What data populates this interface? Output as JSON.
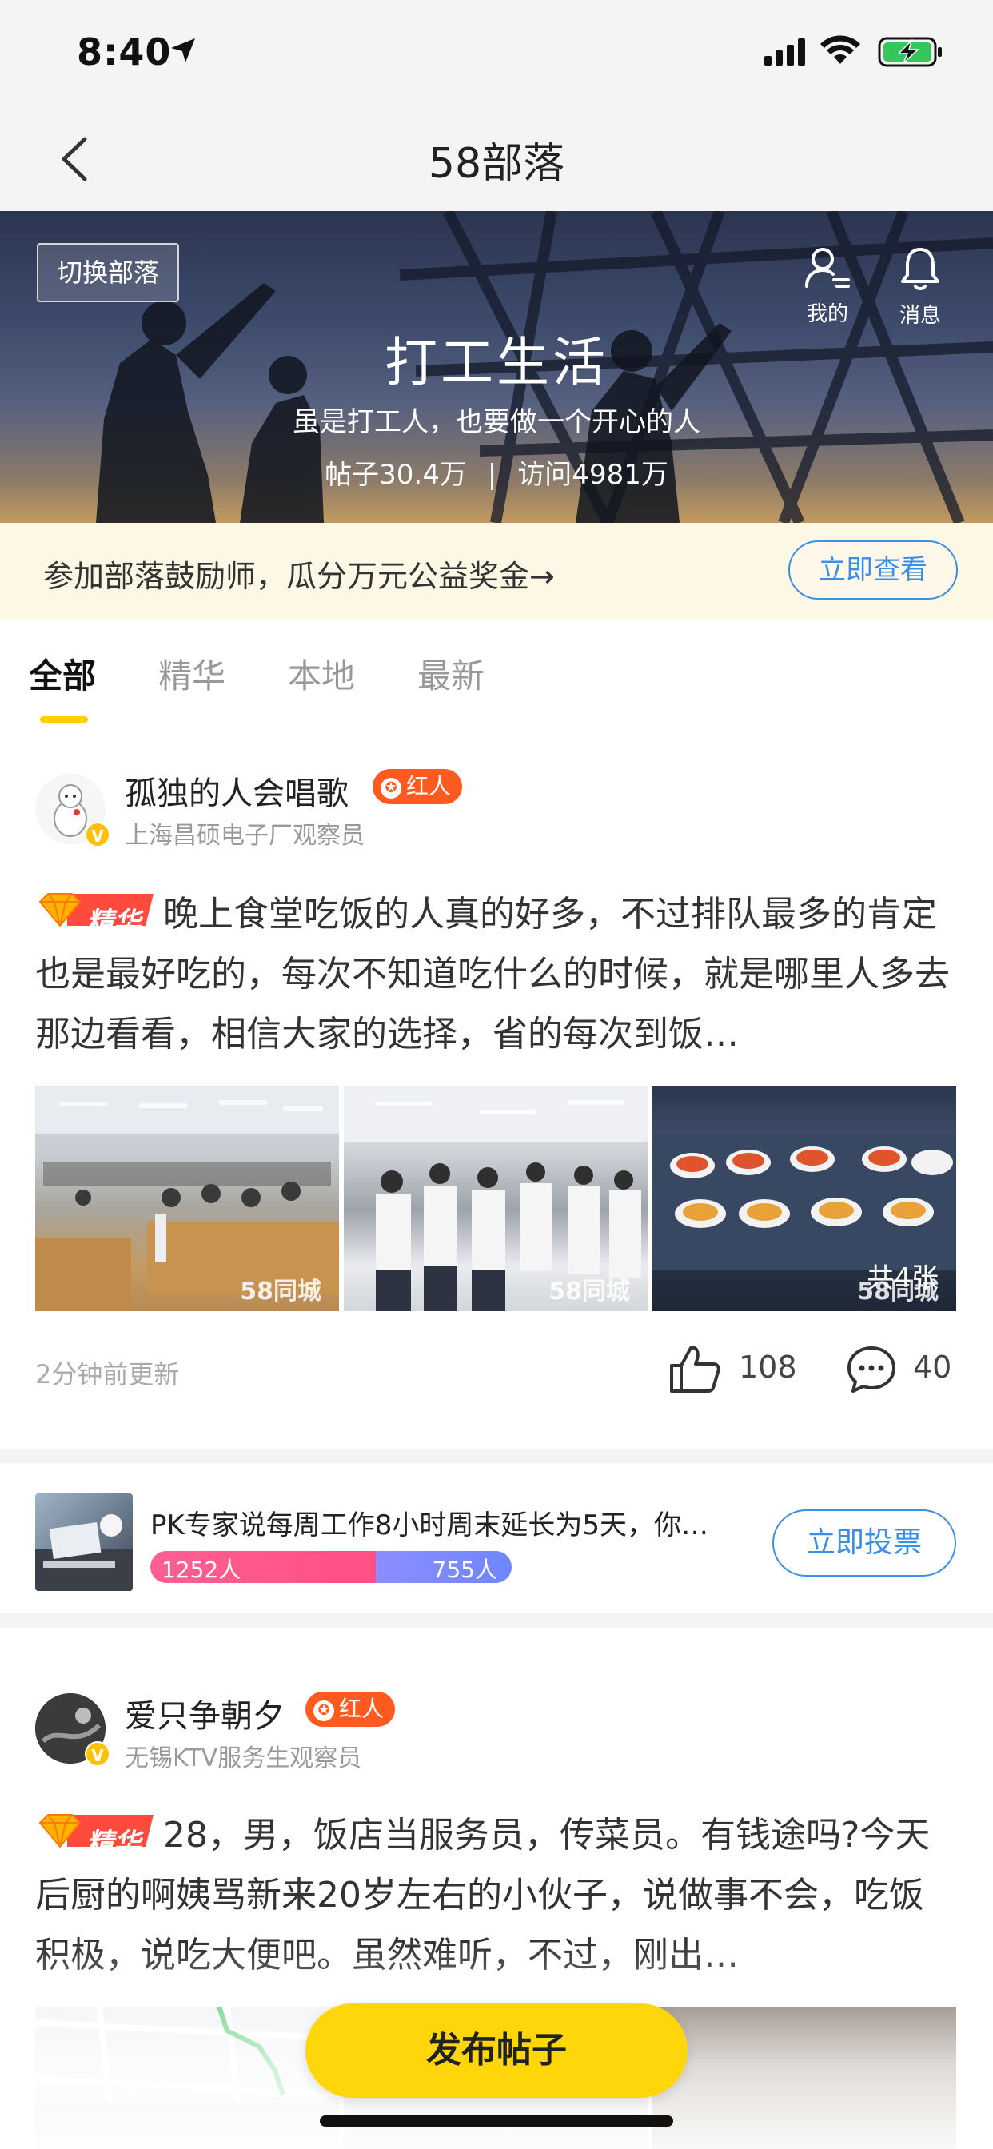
{
  "status_bar": {
    "time": "8:40"
  },
  "nav": {
    "title": "58部落"
  },
  "banner": {
    "switch_label": "切换部落",
    "title": "打工生活",
    "subtitle": "虽是打工人，也要做一个开心的人",
    "posts_stat": "帖子30.4万",
    "separator": "|",
    "visits_stat": "访问4981万",
    "mine_label": "我的",
    "messages_label": "消息"
  },
  "promo": {
    "text": "参加部落鼓励师，瓜分万元公益奖金→",
    "button": "立即查看"
  },
  "tabs": [
    {
      "label": "全部",
      "active": true
    },
    {
      "label": "精华",
      "active": false
    },
    {
      "label": "本地",
      "active": false
    },
    {
      "label": "最新",
      "active": false
    }
  ],
  "posts": [
    {
      "author": "孤独的人会唱歌",
      "badge": "红人",
      "desc": "上海昌硕电子厂观察员",
      "tag": "精华",
      "body": "晚上食堂吃饭的人真的好多，不过排队最多的肯定也是最好吃的，每次不知道吃什么的时候，就是哪里人多去那边看看，相信大家的选择，省的每次到饭…",
      "watermark": "58同城",
      "image_count": "共4张",
      "time": "2分钟前更新",
      "likes": "108",
      "comments": "40"
    },
    {
      "author": "爱只争朝夕",
      "badge": "红人",
      "desc": "无锡KTV服务生观察员",
      "tag": "精华",
      "body": "28，男，饭店当服务员，传菜员。有钱途吗?今天后厨的啊姨骂新来20岁左右的小伙子，说做事不会，吃饭积极，说吃大便吧。虽然难听，不过，刚出…"
    }
  ],
  "vote": {
    "title": "PK专家说每周工作8小时周末延长为5天，你…",
    "option_a": "1252人",
    "option_b": "755人",
    "share_a": 0.624,
    "button": "立即投票"
  },
  "publish_button": "发布帖子",
  "colors": {
    "accent_yellow": "#ffd60a",
    "link_blue": "#3d8ee6",
    "badge_orange": "#ff5a1f"
  }
}
